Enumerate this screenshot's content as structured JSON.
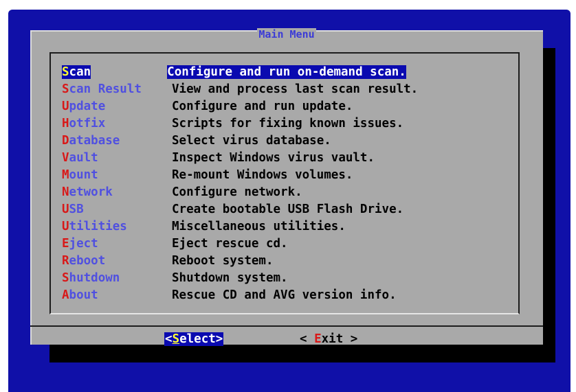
{
  "dialog": {
    "title": "Main Menu"
  },
  "menu": {
    "items": [
      {
        "hot": "S",
        "rest": "can",
        "desc": "Configure and run on-demand scan.",
        "selected": true
      },
      {
        "hot": "S",
        "rest": "can Result",
        "desc": "View and process last scan result."
      },
      {
        "hot": "U",
        "rest": "pdate",
        "desc": "Configure and run update."
      },
      {
        "hot": "H",
        "rest": "otfix",
        "desc": "Scripts for fixing known issues."
      },
      {
        "hot": "D",
        "rest": "atabase",
        "desc": "Select virus database."
      },
      {
        "hot": "V",
        "rest": "ault",
        "desc": "Inspect Windows virus vault."
      },
      {
        "hot": "M",
        "rest": "ount",
        "desc": "Re-mount Windows volumes."
      },
      {
        "hot": "N",
        "rest": "etwork",
        "desc": "Configure network."
      },
      {
        "hot": "U",
        "rest": "SB",
        "desc": "Create bootable USB Flash Drive."
      },
      {
        "hot": "U",
        "rest": "tilities",
        "desc": "Miscellaneous utilities."
      },
      {
        "hot": "E",
        "rest": "ject",
        "desc": "Eject rescue cd."
      },
      {
        "hot": "R",
        "rest": "eboot",
        "desc": "Reboot system."
      },
      {
        "hot": "S",
        "rest": "hutdown",
        "desc": "Shutdown system."
      },
      {
        "hot": "A",
        "rest": "bout",
        "desc": "Rescue CD and AVG version info."
      }
    ]
  },
  "buttons": {
    "select": {
      "open": "<",
      "hot": "S",
      "rest": "elect",
      "close": ">"
    },
    "exit": {
      "open": "< ",
      "hot": "E",
      "rest": "xit",
      "close": " >"
    }
  }
}
